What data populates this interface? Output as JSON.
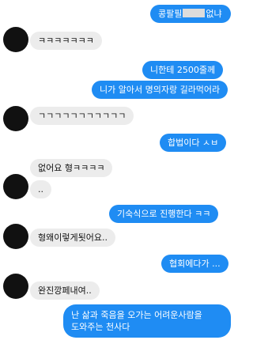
{
  "messages": [
    {
      "from": "me",
      "text_before": "콩팔필",
      "text_after": "없냐"
    },
    {
      "from": "them",
      "text": "ㅋㅋㅋㅋㅋㅋㅋ"
    },
    {
      "from": "me",
      "text": "니한테 2500줄께"
    },
    {
      "from": "me",
      "text": "니가 알아서 명의자랑 길라먹어라"
    },
    {
      "from": "them",
      "text": "ㄱㄱㄱㄱㄱㄱㄱㄱㄱㄱㄱ"
    },
    {
      "from": "me",
      "text": "합법이다 ㅅㅂ"
    },
    {
      "from": "them",
      "text": "없어요 형ㅋㅋㅋㅋ"
    },
    {
      "from": "them",
      "text": ".."
    },
    {
      "from": "me",
      "text": "기숙식으로 진행한다 ㅋㅋ"
    },
    {
      "from": "them",
      "text": "형왜이렇게됫어요.."
    },
    {
      "from": "me",
      "text": "협회에다가 ..."
    },
    {
      "from": "them",
      "text": "완진깡페내여.."
    },
    {
      "from": "me",
      "line1": "난 삶과 죽음을 오가는 어려운사람을",
      "line2": "도와주는 천사다"
    }
  ]
}
